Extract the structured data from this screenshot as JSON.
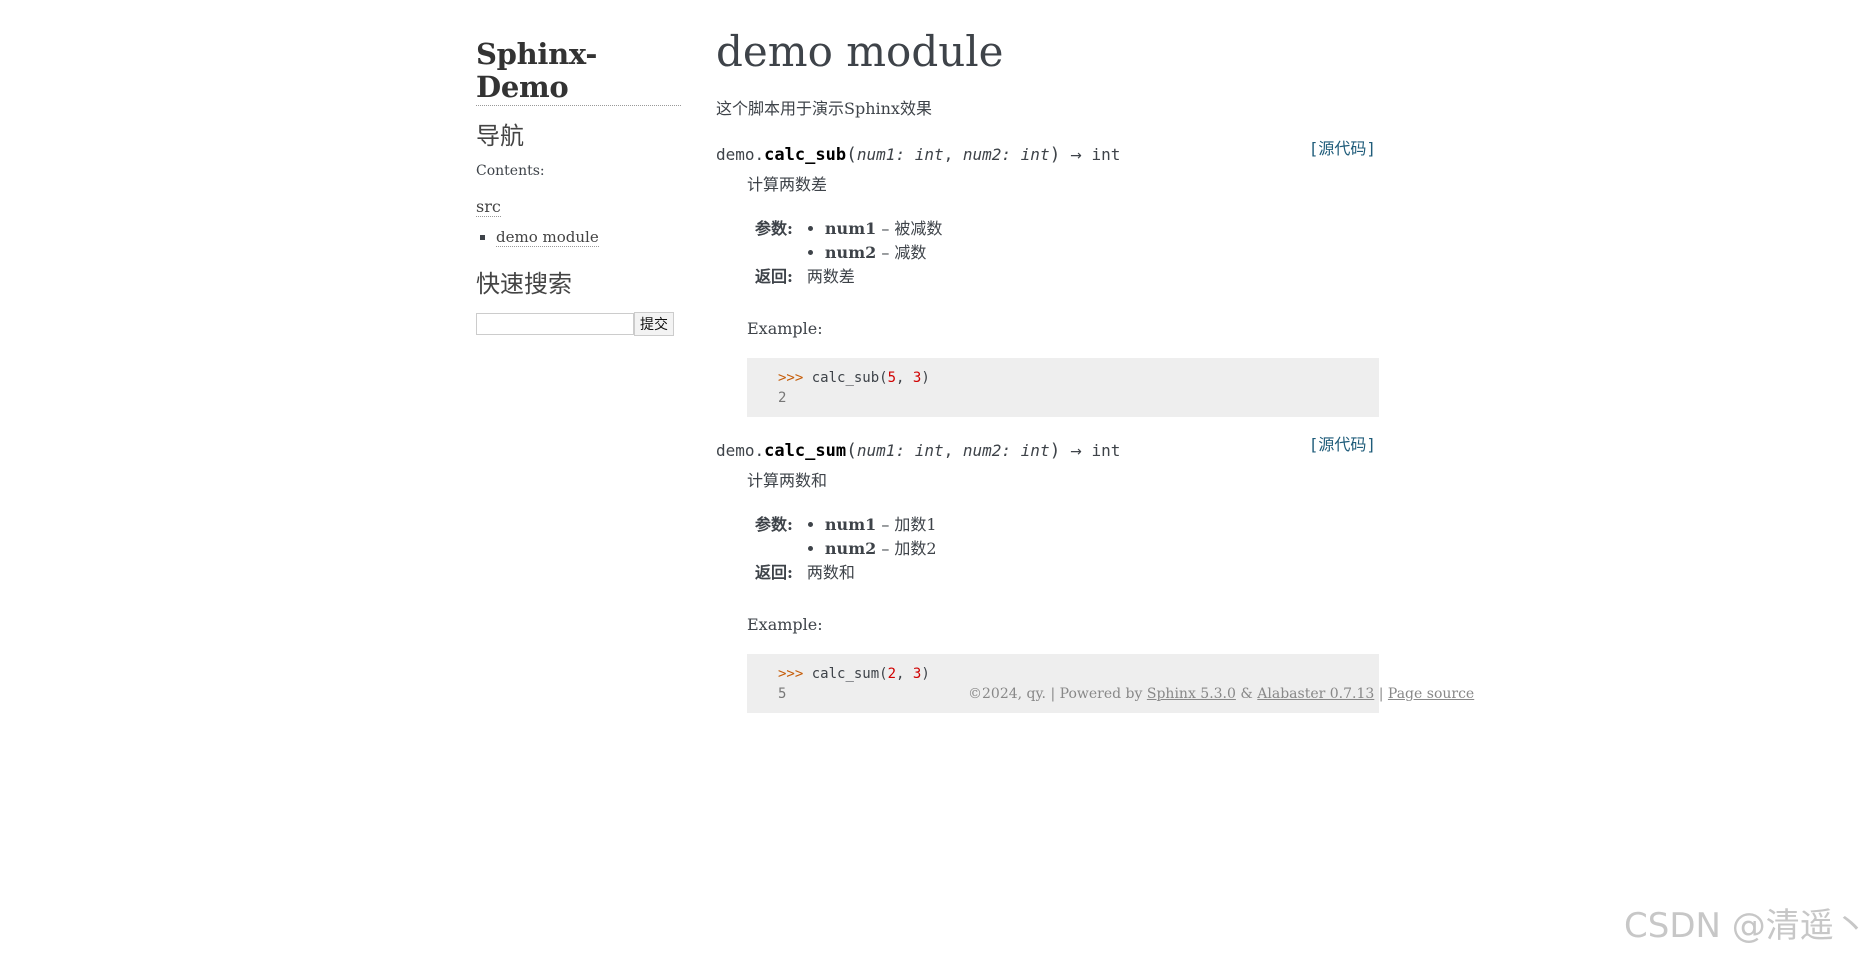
{
  "sidebar": {
    "logo": "Sphinx-Demo",
    "nav_heading": "导航",
    "contents_caption": "Contents:",
    "toc_root": "src",
    "toc_items": [
      "demo module"
    ],
    "search_heading": "快速搜索",
    "search_value": "",
    "search_button": "提交"
  },
  "main": {
    "title": "demo module",
    "intro": "这个脚本用于演示Sphinx效果",
    "functions": [
      {
        "prefix": "demo.",
        "name": "calc_sub",
        "param1": "num1: int",
        "param2": "num2: int",
        "arrow": "→",
        "returns_type": "int",
        "source_link": "[源代码]",
        "description": "计算两数差",
        "params_label": "参数:",
        "params": [
          {
            "name": "num1",
            "desc": " – 被减数"
          },
          {
            "name": "num2",
            "desc": " – 减数"
          }
        ],
        "returns_label": "返回:",
        "returns": "两数差",
        "example_label": "Example:",
        "code_prompt": ">>>",
        "code_call_prefix": "calc_sub(",
        "code_arg1": "5",
        "code_sep": ", ",
        "code_arg2": "3",
        "code_close": ")",
        "code_output": "2"
      },
      {
        "prefix": "demo.",
        "name": "calc_sum",
        "param1": "num1: int",
        "param2": "num2: int",
        "arrow": "→",
        "returns_type": "int",
        "source_link": "[源代码]",
        "description": "计算两数和",
        "params_label": "参数:",
        "params": [
          {
            "name": "num1",
            "desc": " – 加数1"
          },
          {
            "name": "num2",
            "desc": " – 加数2"
          }
        ],
        "returns_label": "返回:",
        "returns": "两数和",
        "example_label": "Example:",
        "code_prompt": ">>>",
        "code_call_prefix": "calc_sum(",
        "code_arg1": "2",
        "code_sep": ", ",
        "code_arg2": "3",
        "code_close": ")",
        "code_output": "5"
      }
    ]
  },
  "footer": {
    "copyright": "©2024, qy. | Powered by ",
    "sphinx_link": "Sphinx 5.3.0",
    "amp": " & ",
    "alabaster_link": "Alabaster 0.7.13",
    "sep": " | ",
    "page_source": "Page source"
  },
  "watermark": "CSDN @清遥丶"
}
